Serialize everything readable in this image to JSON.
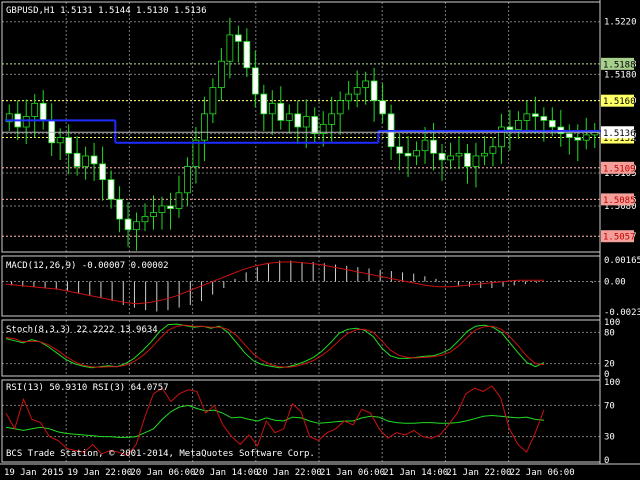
{
  "chart_data": [
    {
      "type": "candlestick",
      "title": "GBPUSD,H1  1.5131 1.5144 1.5130 1.5136",
      "ylim": [
        1.5045,
        1.5235
      ],
      "y_ticks": [
        "1.5220",
        "1.5188",
        "1.5180",
        "1.5160",
        "1.5135",
        "1.5132",
        "1.5109",
        "1.5105",
        "1.5085",
        "1.5080",
        "1.5057"
      ],
      "levels": [
        {
          "value": 1.5188,
          "label": "1.5188",
          "color": "#a8d08d",
          "text_color": "#000000"
        },
        {
          "value": 1.516,
          "label": "1.5160",
          "color": "#ffff66",
          "text_color": "#000000"
        },
        {
          "value": 1.5132,
          "label": "1.5132",
          "color": "#ffff66",
          "text_color": "#000000"
        },
        {
          "value": 1.5109,
          "label": "1.5109",
          "color": "#f4a09a",
          "text_color": "#c00000"
        },
        {
          "value": 1.5085,
          "label": "1.5085",
          "color": "#f4a09a",
          "text_color": "#c00000"
        },
        {
          "value": 1.5057,
          "label": "1.5057",
          "color": "#f4a09a",
          "text_color": "#c00000"
        }
      ],
      "current_price": {
        "value": 1.5136,
        "label": "1.5136"
      },
      "closes": [
        1.515,
        1.514,
        1.5148,
        1.5158,
        1.5145,
        1.5128,
        1.5132,
        1.512,
        1.511,
        1.5118,
        1.5112,
        1.51,
        1.5085,
        1.507,
        1.5062,
        1.5068,
        1.5072,
        1.5075,
        1.508,
        1.5078,
        1.509,
        1.511,
        1.513,
        1.515,
        1.517,
        1.519,
        1.521,
        1.5205,
        1.5185,
        1.5165,
        1.515,
        1.5158,
        1.5145,
        1.515,
        1.514,
        1.5148,
        1.5135,
        1.5142,
        1.515,
        1.516,
        1.5165,
        1.517,
        1.5175,
        1.516,
        1.515,
        1.5125,
        1.512,
        1.5118,
        1.5122,
        1.513,
        1.512,
        1.5115,
        1.5118,
        1.512,
        1.511,
        1.5118,
        1.512,
        1.5125,
        1.514,
        1.5138,
        1.5145,
        1.515,
        1.5148,
        1.5145,
        1.514,
        1.5135,
        1.5132,
        1.513,
        1.5134,
        1.5136
      ],
      "ma": [
        [
          1.5145,
          0,
          12
        ],
        [
          1.5128,
          13,
          43
        ],
        [
          1.5137,
          44,
          70
        ]
      ],
      "x_labels": [
        "19 Jan 2015",
        "19 Jan 22:00",
        "20 Jan 06:00",
        "20 Jan 14:00",
        "20 Jan 22:00",
        "21 Jan 06:00",
        "21 Jan 14:00",
        "21 Jan 22:00",
        "22 Jan 06:00"
      ]
    },
    {
      "type": "bar",
      "title": "MACD(12,26,9) -0.00007 0.00002",
      "y_ticks": [
        "0.00165",
        "0.00",
        "-0.00234"
      ],
      "ylim": [
        -0.00234,
        0.00165
      ],
      "values": [
        -0.0003,
        -0.0004,
        -0.0004,
        -0.0005,
        -0.0006,
        -0.0007,
        -0.0009,
        -0.0011,
        -0.0013,
        -0.0015,
        -0.0018,
        -0.002,
        -0.0022,
        -0.0023,
        -0.0022,
        -0.002,
        -0.0018,
        -0.0015,
        -0.001,
        -0.0005,
        0.0002,
        0.0007,
        0.0011,
        0.0014,
        0.0016,
        0.0016,
        0.0015,
        0.0015,
        0.0014,
        0.0013,
        0.0012,
        0.0011,
        0.001,
        0.0009,
        0.0008,
        0.0007,
        0.0006,
        0.0004,
        0.0002,
        -0.0001,
        -0.0003,
        -0.0004,
        -0.0005,
        -0.0005,
        -0.0004,
        -0.0003,
        -0.0002,
        -0.0001,
        0.0,
        0.0001,
        0.0001,
        0.0,
        -0.0001
      ],
      "signal": [
        -0.0002,
        -0.0003,
        -0.0004,
        -0.0005,
        -0.0006,
        -0.0008,
        -0.001,
        -0.0012,
        -0.0014,
        -0.0016,
        -0.0017,
        -0.0016,
        -0.0014,
        -0.0011,
        -0.0007,
        -0.0003,
        0.0001,
        0.0005,
        0.0009,
        0.0012,
        0.0014,
        0.0015,
        0.0015,
        0.0014,
        0.0013,
        0.0011,
        0.0009,
        0.0007,
        0.0005,
        0.0003,
        0.0001,
        -0.0001,
        -0.0003,
        -0.0004,
        -0.0004,
        -0.0003,
        -0.0002,
        -0.0001,
        0.0,
        0.0001,
        0.0001,
        0.0001
      ]
    },
    {
      "type": "line",
      "title": "Stoch(8,3,3) 22.2222 13.9634",
      "y_ticks": [
        "100",
        "80",
        "20",
        "0"
      ],
      "ylim": [
        0,
        100
      ],
      "series": [
        {
          "values": [
            68,
            64,
            60,
            66,
            62,
            52,
            40,
            28,
            20,
            15,
            12,
            14,
            16,
            14,
            20,
            30,
            45,
            62,
            82,
            95,
            96,
            93,
            90,
            92,
            88,
            92,
            80,
            60,
            40,
            25,
            18,
            15,
            12,
            14,
            18,
            24,
            32,
            44,
            60,
            78,
            86,
            88,
            84,
            72,
            50,
            35,
            30,
            30,
            32,
            34,
            35,
            40,
            48,
            64,
            82,
            92,
            94,
            90,
            80,
            60,
            40,
            22,
            14,
            22
          ],
          "color": "#22dd22"
        },
        {
          "values": [
            70,
            68,
            62,
            63,
            62,
            56,
            46,
            34,
            24,
            17,
            14,
            13,
            14,
            14,
            17,
            24,
            35,
            50,
            68,
            84,
            92,
            94,
            92,
            92,
            90,
            90,
            86,
            74,
            56,
            38,
            26,
            18,
            14,
            13,
            15,
            20,
            26,
            36,
            48,
            64,
            78,
            85,
            86,
            80,
            64,
            46,
            36,
            32,
            31,
            32,
            33,
            36,
            42,
            54,
            70,
            85,
            91,
            92,
            86,
            72,
            54,
            34,
            20,
            18
          ],
          "color": "#cc1111"
        }
      ]
    },
    {
      "type": "line",
      "title": "RSI(13) 50.9310  RSI(3) 64.0757",
      "y_ticks": [
        "100",
        "70",
        "30",
        "0"
      ],
      "ylim": [
        0,
        100
      ],
      "series": [
        {
          "values": [
            42,
            40,
            38,
            40,
            42,
            40,
            36,
            34,
            33,
            32,
            31,
            30,
            30,
            29,
            29,
            30,
            35,
            40,
            52,
            62,
            68,
            70,
            66,
            63,
            64,
            60,
            54,
            55,
            52,
            50,
            54,
            51,
            50,
            55,
            54,
            50,
            47,
            48,
            49,
            50,
            50,
            54,
            56,
            55,
            50,
            48,
            47,
            47,
            48,
            48,
            47,
            47,
            48,
            50,
            53,
            56,
            57,
            56,
            55,
            54,
            55,
            52,
            51
          ],
          "color": "#22dd22"
        },
        {
          "values": [
            60,
            40,
            78,
            52,
            48,
            30,
            25,
            15,
            12,
            10,
            20,
            8,
            12,
            10,
            6,
            20,
            55,
            85,
            92,
            75,
            85,
            90,
            88,
            60,
            70,
            45,
            30,
            20,
            32,
            18,
            50,
            35,
            40,
            72,
            62,
            30,
            25,
            35,
            40,
            50,
            45,
            65,
            60,
            40,
            28,
            35,
            32,
            38,
            30,
            28,
            32,
            45,
            60,
            85,
            92,
            88,
            95,
            80,
            40,
            20,
            10,
            35,
            64
          ],
          "color": "#cc1111"
        }
      ]
    }
  ],
  "footer": "BCS Trade Station, © 2001-2014, MetaQuotes Software Corp."
}
